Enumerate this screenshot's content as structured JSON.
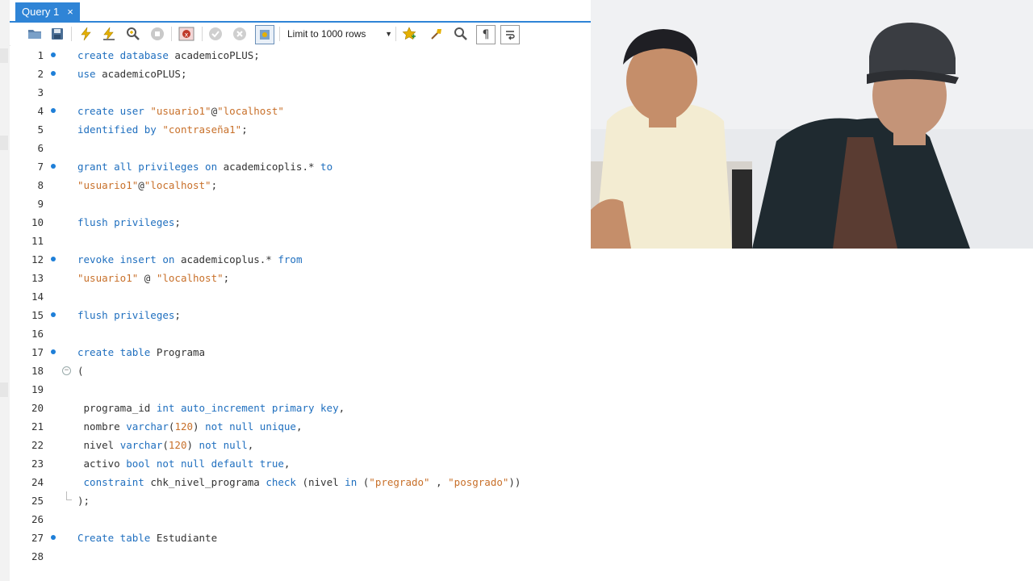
{
  "tab": {
    "title": "Query 1",
    "close": "×"
  },
  "toolbar": {
    "limit_label": "Limit to 1000 rows",
    "icons": [
      "open-folder-icon",
      "save-icon",
      "execute-icon",
      "execute-cursor-icon",
      "explain-icon",
      "stop-icon",
      "toggle-error-icon",
      "commit-icon",
      "rollback-icon",
      "autocommit-icon",
      "favorite-icon",
      "beautify-icon",
      "find-icon",
      "invisible-chars-icon",
      "wrap-icon"
    ]
  },
  "editor": {
    "lines": [
      {
        "n": "1",
        "dot": true,
        "segments": [
          [
            "kw",
            "create database"
          ],
          [
            "",
            "academicoPLUS;"
          ]
        ]
      },
      {
        "n": "2",
        "dot": true,
        "segments": [
          [
            "kw",
            "use"
          ],
          [
            "",
            "academicoPLUS;"
          ]
        ]
      },
      {
        "n": "3",
        "dot": false,
        "segments": []
      },
      {
        "n": "4",
        "dot": true,
        "segments": [
          [
            "kw",
            "create user"
          ],
          [
            "str",
            " \"usuario1\""
          ],
          [
            "",
            "@"
          ],
          [
            "str",
            "\"localhost\""
          ]
        ]
      },
      {
        "n": "5",
        "dot": false,
        "segments": [
          [
            "kw",
            "identified by"
          ],
          [
            "str",
            " \"contraseña1\""
          ],
          [
            "",
            ";"
          ]
        ]
      },
      {
        "n": "6",
        "dot": false,
        "segments": []
      },
      {
        "n": "7",
        "dot": true,
        "segments": [
          [
            "kw",
            "grant all privileges on"
          ],
          [
            "",
            " academicoplis.*"
          ],
          [
            "kw",
            " to"
          ]
        ]
      },
      {
        "n": "8",
        "dot": false,
        "segments": [
          [
            "str",
            "\"usuario1\""
          ],
          [
            "",
            "@"
          ],
          [
            "str",
            "\"localhost\""
          ],
          [
            "",
            ";"
          ]
        ]
      },
      {
        "n": "9",
        "dot": false,
        "segments": []
      },
      {
        "n": "10",
        "dot": false,
        "segments": [
          [
            "kw",
            "flush privileges"
          ],
          [
            "",
            ";"
          ]
        ]
      },
      {
        "n": "11",
        "dot": false,
        "segments": []
      },
      {
        "n": "12",
        "dot": true,
        "segments": [
          [
            "kw",
            "revoke insert on"
          ],
          [
            "",
            " academicoplus.*"
          ],
          [
            "kw",
            " from"
          ]
        ]
      },
      {
        "n": "13",
        "dot": false,
        "segments": [
          [
            "str",
            "\"usuario1\""
          ],
          [
            "",
            " @ "
          ],
          [
            "str",
            "\"localhost\""
          ],
          [
            "",
            ";"
          ]
        ]
      },
      {
        "n": "14",
        "dot": false,
        "segments": []
      },
      {
        "n": "15",
        "dot": true,
        "segments": [
          [
            "kw",
            "flush privileges"
          ],
          [
            "",
            ";"
          ]
        ]
      },
      {
        "n": "16",
        "dot": false,
        "segments": []
      },
      {
        "n": "17",
        "dot": true,
        "segments": [
          [
            "kw",
            "create table"
          ],
          [
            "",
            " Programa"
          ]
        ]
      },
      {
        "n": "18",
        "dot": false,
        "fold": "open",
        "segments": [
          [
            "",
            "("
          ]
        ]
      },
      {
        "n": "19",
        "dot": false,
        "segments": []
      },
      {
        "n": "20",
        "dot": false,
        "segments": [
          [
            "",
            " programa_id "
          ],
          [
            "kw",
            "int auto_increment primary key"
          ],
          [
            "",
            ","
          ]
        ]
      },
      {
        "n": "21",
        "dot": false,
        "segments": [
          [
            "",
            " nombre "
          ],
          [
            "kw",
            "varchar"
          ],
          [
            "",
            "("
          ],
          [
            "num",
            "120"
          ],
          [
            "",
            ") "
          ],
          [
            "kw",
            "not null unique"
          ],
          [
            "",
            ","
          ]
        ]
      },
      {
        "n": "22",
        "dot": false,
        "segments": [
          [
            "",
            " nivel "
          ],
          [
            "kw",
            "varchar"
          ],
          [
            "",
            "("
          ],
          [
            "num",
            "120"
          ],
          [
            "",
            ") "
          ],
          [
            "kw",
            "not null"
          ],
          [
            "",
            ","
          ]
        ]
      },
      {
        "n": "23",
        "dot": false,
        "segments": [
          [
            "",
            " activo "
          ],
          [
            "kw",
            "bool not null default true"
          ],
          [
            "",
            ","
          ]
        ]
      },
      {
        "n": "24",
        "dot": false,
        "segments": [
          [
            "",
            " "
          ],
          [
            "kw",
            "constraint"
          ],
          [
            "",
            " chk_nivel_programa "
          ],
          [
            "kw",
            "check"
          ],
          [
            "",
            " (nivel "
          ],
          [
            "kw",
            "in"
          ],
          [
            "",
            " ("
          ],
          [
            "str",
            "\"pregrado\""
          ],
          [
            "",
            " , "
          ],
          [
            "str",
            "\"posgrado\""
          ],
          [
            "",
            "))"
          ]
        ]
      },
      {
        "n": "25",
        "dot": false,
        "fold": "end",
        "segments": [
          [
            "",
            ");"
          ]
        ]
      },
      {
        "n": "26",
        "dot": false,
        "segments": []
      },
      {
        "n": "27",
        "dot": true,
        "segments": [
          [
            "kw",
            "Create table"
          ],
          [
            "",
            " Estudiante"
          ]
        ]
      },
      {
        "n": "28",
        "dot": false,
        "segments": []
      }
    ]
  },
  "colors": {
    "accent": "#2f84d6",
    "keyword": "#1f6fbf",
    "string": "#c8702a"
  }
}
